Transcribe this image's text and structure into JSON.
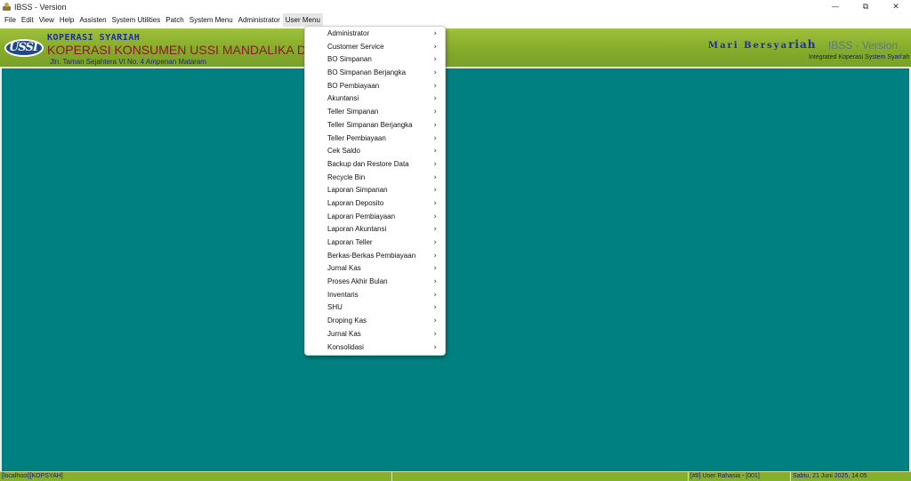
{
  "window": {
    "title": "IBSS - Version",
    "controls": {
      "minimize": "—",
      "restore": "⧉",
      "close": "✕"
    }
  },
  "menubar": {
    "items": [
      "File",
      "Edit",
      "View",
      "Help",
      "Assisten",
      "System Utilities",
      "Patch",
      "System Menu",
      "Administrator",
      "User Menu"
    ],
    "active": "User Menu"
  },
  "banner": {
    "brand_small": "KOPERASI SYARIAH",
    "brand_big": "KOPERASI KONSUMEN USSI MANDALIKA DIGITAL",
    "address": "Jln. Taman Sejahtera VI No. 4 Ampenan Mataram",
    "tagline_prefix": "Mari Bersya",
    "tagline_suffix": "riah",
    "product": "IBSS - Version",
    "product_sub": "Integrated Koperasi System Syari'ah",
    "logo_text": "USSI",
    "colors": {
      "green": "#85ab2a",
      "brand_red": "#8b1a2a",
      "brand_blue": "#1d2f9a"
    }
  },
  "workspace": {
    "background": "#008080"
  },
  "user_menu": {
    "items": [
      "Administrator",
      "Customer Service",
      "BO Simpanan",
      "BO Simpanan Berjangka",
      "BO Pembiayaan",
      "Akuntansi",
      "Teller Simpanan",
      "Teller Simpanan Berjangka",
      "Teller Pembiayaan",
      "Cek Saldo",
      "Backup dan Restore Data",
      "Recycle Bin",
      "Laporan Simpanan",
      "Laporan Deposito",
      "Laporan Pembiayaan",
      "Laporan Akuntansi",
      "Laporan Teller",
      "Berkas-Berkas Pembiayaan",
      "Jurnal Kas",
      "Proses Akhir Bulan",
      "Inventaris",
      "SHU",
      "Droping Kas",
      "Jurnal Kas",
      "Konsolidasi"
    ],
    "submenu_arrow": "›"
  },
  "statusbar": {
    "connection": "[localhost][KOPSYAH]",
    "user": "[#8] User Rahasia - [001]",
    "datetime": "Sabtu, 21 Juni 2025, 14:05"
  }
}
